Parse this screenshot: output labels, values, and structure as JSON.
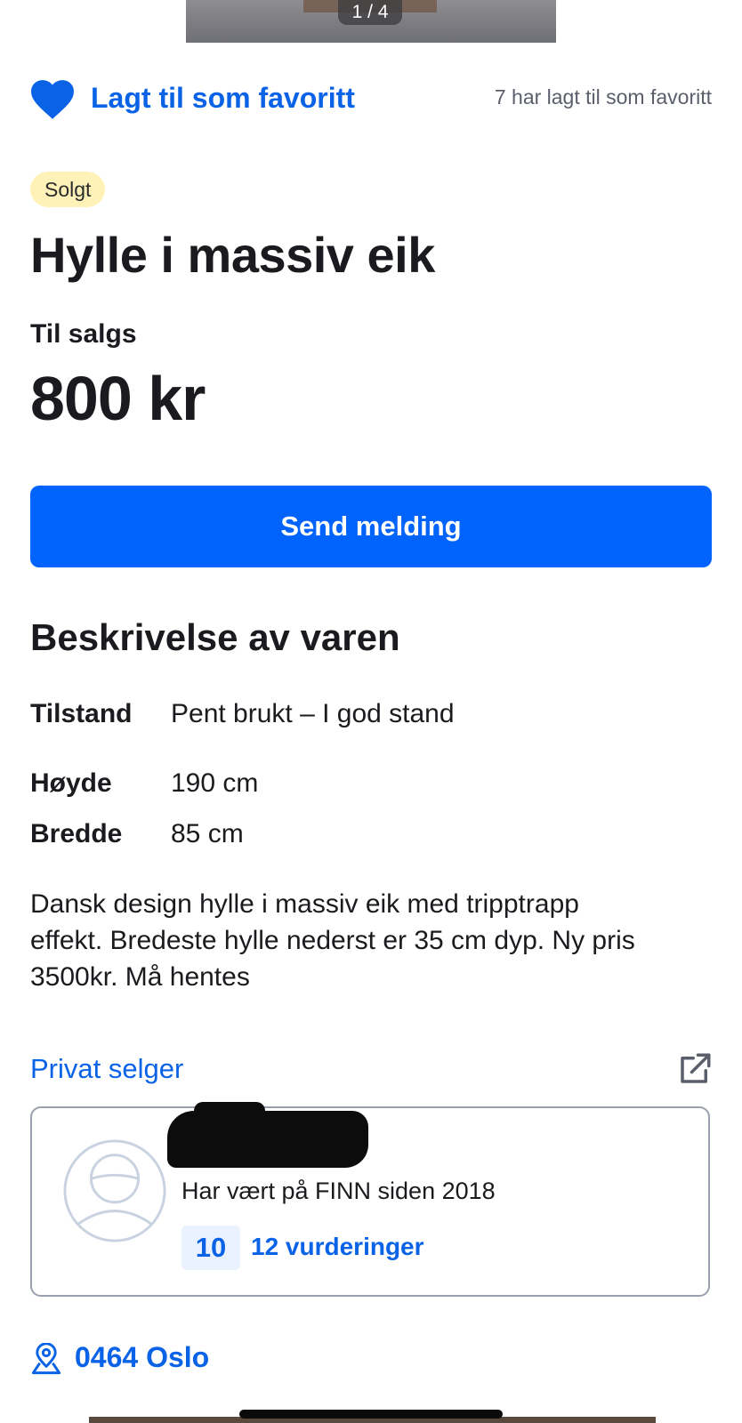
{
  "gallery": {
    "counter": "1 / 4"
  },
  "favorite": {
    "label": "Lagt til som favoritt",
    "count_text": "7 har lagt til som favoritt"
  },
  "listing": {
    "status_badge": "Solgt",
    "title": "Hylle i massiv eik",
    "type": "Til salgs",
    "price": "800 kr"
  },
  "actions": {
    "send_message": "Send melding"
  },
  "description": {
    "heading": "Beskrivelse av varen",
    "attributes": [
      {
        "key": "Tilstand",
        "value": "Pent brukt – I god stand"
      },
      {
        "key": "Høyde",
        "value": "190 cm"
      },
      {
        "key": "Bredde",
        "value": "85 cm"
      }
    ],
    "text_lines": [
      "Dansk design hylle i massiv eik med tripptrapp",
      "effekt. Bredeste hylle nederst er 35 cm dyp. Ny pris",
      "3500kr. Må hentes"
    ]
  },
  "seller": {
    "type": "Privat selger",
    "since": "Har vært på FINN siden 2018",
    "score": "10",
    "reviews": "12 vurderinger"
  },
  "location": {
    "text": "0464 Oslo"
  },
  "icons": {
    "heart": "heart-icon",
    "external": "external-link-icon",
    "avatar": "avatar-placeholder-icon",
    "pin": "location-pin-icon"
  },
  "colors": {
    "accent": "#0063fb",
    "link": "#0a63e6",
    "sold_badge": "#fff2b8"
  }
}
